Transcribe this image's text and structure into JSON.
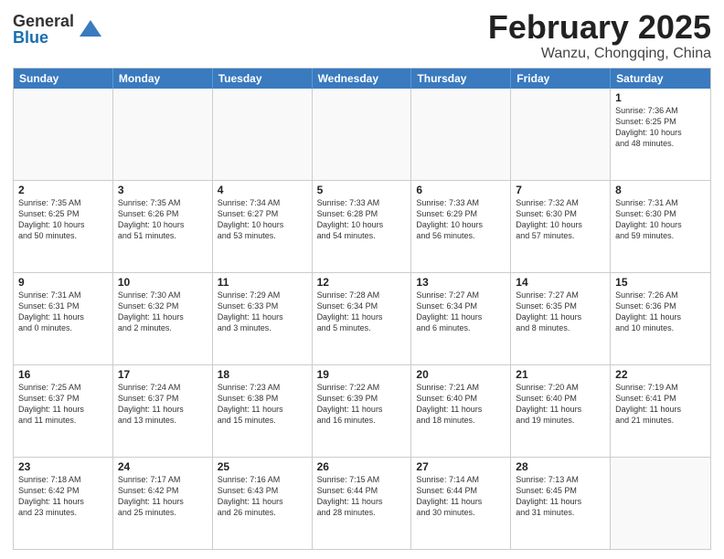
{
  "header": {
    "logo_general": "General",
    "logo_blue": "Blue",
    "month_title": "February 2025",
    "location": "Wanzu, Chongqing, China"
  },
  "calendar": {
    "days_of_week": [
      "Sunday",
      "Monday",
      "Tuesday",
      "Wednesday",
      "Thursday",
      "Friday",
      "Saturday"
    ],
    "rows": [
      [
        {
          "day": "",
          "info": "",
          "empty": true
        },
        {
          "day": "",
          "info": "",
          "empty": true
        },
        {
          "day": "",
          "info": "",
          "empty": true
        },
        {
          "day": "",
          "info": "",
          "empty": true
        },
        {
          "day": "",
          "info": "",
          "empty": true
        },
        {
          "day": "",
          "info": "",
          "empty": true
        },
        {
          "day": "1",
          "info": "Sunrise: 7:36 AM\nSunset: 6:25 PM\nDaylight: 10 hours\nand 48 minutes.",
          "empty": false
        }
      ],
      [
        {
          "day": "2",
          "info": "Sunrise: 7:35 AM\nSunset: 6:25 PM\nDaylight: 10 hours\nand 50 minutes.",
          "empty": false
        },
        {
          "day": "3",
          "info": "Sunrise: 7:35 AM\nSunset: 6:26 PM\nDaylight: 10 hours\nand 51 minutes.",
          "empty": false
        },
        {
          "day": "4",
          "info": "Sunrise: 7:34 AM\nSunset: 6:27 PM\nDaylight: 10 hours\nand 53 minutes.",
          "empty": false
        },
        {
          "day": "5",
          "info": "Sunrise: 7:33 AM\nSunset: 6:28 PM\nDaylight: 10 hours\nand 54 minutes.",
          "empty": false
        },
        {
          "day": "6",
          "info": "Sunrise: 7:33 AM\nSunset: 6:29 PM\nDaylight: 10 hours\nand 56 minutes.",
          "empty": false
        },
        {
          "day": "7",
          "info": "Sunrise: 7:32 AM\nSunset: 6:30 PM\nDaylight: 10 hours\nand 57 minutes.",
          "empty": false
        },
        {
          "day": "8",
          "info": "Sunrise: 7:31 AM\nSunset: 6:30 PM\nDaylight: 10 hours\nand 59 minutes.",
          "empty": false
        }
      ],
      [
        {
          "day": "9",
          "info": "Sunrise: 7:31 AM\nSunset: 6:31 PM\nDaylight: 11 hours\nand 0 minutes.",
          "empty": false
        },
        {
          "day": "10",
          "info": "Sunrise: 7:30 AM\nSunset: 6:32 PM\nDaylight: 11 hours\nand 2 minutes.",
          "empty": false
        },
        {
          "day": "11",
          "info": "Sunrise: 7:29 AM\nSunset: 6:33 PM\nDaylight: 11 hours\nand 3 minutes.",
          "empty": false
        },
        {
          "day": "12",
          "info": "Sunrise: 7:28 AM\nSunset: 6:34 PM\nDaylight: 11 hours\nand 5 minutes.",
          "empty": false
        },
        {
          "day": "13",
          "info": "Sunrise: 7:27 AM\nSunset: 6:34 PM\nDaylight: 11 hours\nand 6 minutes.",
          "empty": false
        },
        {
          "day": "14",
          "info": "Sunrise: 7:27 AM\nSunset: 6:35 PM\nDaylight: 11 hours\nand 8 minutes.",
          "empty": false
        },
        {
          "day": "15",
          "info": "Sunrise: 7:26 AM\nSunset: 6:36 PM\nDaylight: 11 hours\nand 10 minutes.",
          "empty": false
        }
      ],
      [
        {
          "day": "16",
          "info": "Sunrise: 7:25 AM\nSunset: 6:37 PM\nDaylight: 11 hours\nand 11 minutes.",
          "empty": false
        },
        {
          "day": "17",
          "info": "Sunrise: 7:24 AM\nSunset: 6:37 PM\nDaylight: 11 hours\nand 13 minutes.",
          "empty": false
        },
        {
          "day": "18",
          "info": "Sunrise: 7:23 AM\nSunset: 6:38 PM\nDaylight: 11 hours\nand 15 minutes.",
          "empty": false
        },
        {
          "day": "19",
          "info": "Sunrise: 7:22 AM\nSunset: 6:39 PM\nDaylight: 11 hours\nand 16 minutes.",
          "empty": false
        },
        {
          "day": "20",
          "info": "Sunrise: 7:21 AM\nSunset: 6:40 PM\nDaylight: 11 hours\nand 18 minutes.",
          "empty": false
        },
        {
          "day": "21",
          "info": "Sunrise: 7:20 AM\nSunset: 6:40 PM\nDaylight: 11 hours\nand 19 minutes.",
          "empty": false
        },
        {
          "day": "22",
          "info": "Sunrise: 7:19 AM\nSunset: 6:41 PM\nDaylight: 11 hours\nand 21 minutes.",
          "empty": false
        }
      ],
      [
        {
          "day": "23",
          "info": "Sunrise: 7:18 AM\nSunset: 6:42 PM\nDaylight: 11 hours\nand 23 minutes.",
          "empty": false
        },
        {
          "day": "24",
          "info": "Sunrise: 7:17 AM\nSunset: 6:42 PM\nDaylight: 11 hours\nand 25 minutes.",
          "empty": false
        },
        {
          "day": "25",
          "info": "Sunrise: 7:16 AM\nSunset: 6:43 PM\nDaylight: 11 hours\nand 26 minutes.",
          "empty": false
        },
        {
          "day": "26",
          "info": "Sunrise: 7:15 AM\nSunset: 6:44 PM\nDaylight: 11 hours\nand 28 minutes.",
          "empty": false
        },
        {
          "day": "27",
          "info": "Sunrise: 7:14 AM\nSunset: 6:44 PM\nDaylight: 11 hours\nand 30 minutes.",
          "empty": false
        },
        {
          "day": "28",
          "info": "Sunrise: 7:13 AM\nSunset: 6:45 PM\nDaylight: 11 hours\nand 31 minutes.",
          "empty": false
        },
        {
          "day": "",
          "info": "",
          "empty": true
        }
      ]
    ]
  }
}
